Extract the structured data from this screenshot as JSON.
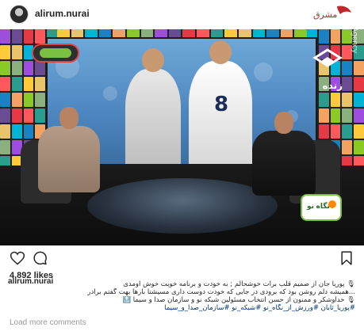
{
  "header": {
    "username": "alirum.nurai",
    "brand_mark_label": "مشرق"
  },
  "media": {
    "network_logo": "tv3-network-logo",
    "channel": "زنده",
    "watermark": "Mashregh News Agency",
    "side_watermark": "Mizon Online News Agency",
    "shirt_number": "8",
    "program_logo": "نگاه نو"
  },
  "post": {
    "likes": "4,892 likes",
    "caption_user": "alirum.nurai",
    "caption_lines": [
      "🎙 پوریا جان از صمیم قلب برات خوشحالم ; به خودت و برنامه خوبت خوش آومدی",
      "...همیشه دلم روشن بود که برودی در جایی که خودت دوست داری مسیشتا بارها بهت گفتم برادر",
      "🎙 خداوشکر و ممنون از حسن انتخاب مسئولین شبکه نو و سازمان صدا و سیما 🔝",
      "#پوریا_ثابان #ورزش_از_نگاه_نو #شبکه_نو #سازمان_صدا_و_سیما"
    ],
    "load_more": "Load more comments"
  },
  "icons": {
    "heart": "heart-icon",
    "comment": "comment-icon",
    "bookmark": "bookmark-icon"
  },
  "colors": {
    "text": "#262626",
    "muted": "#999999",
    "screen_blue": "#4d86bf",
    "accent_green": "#7ac043"
  }
}
